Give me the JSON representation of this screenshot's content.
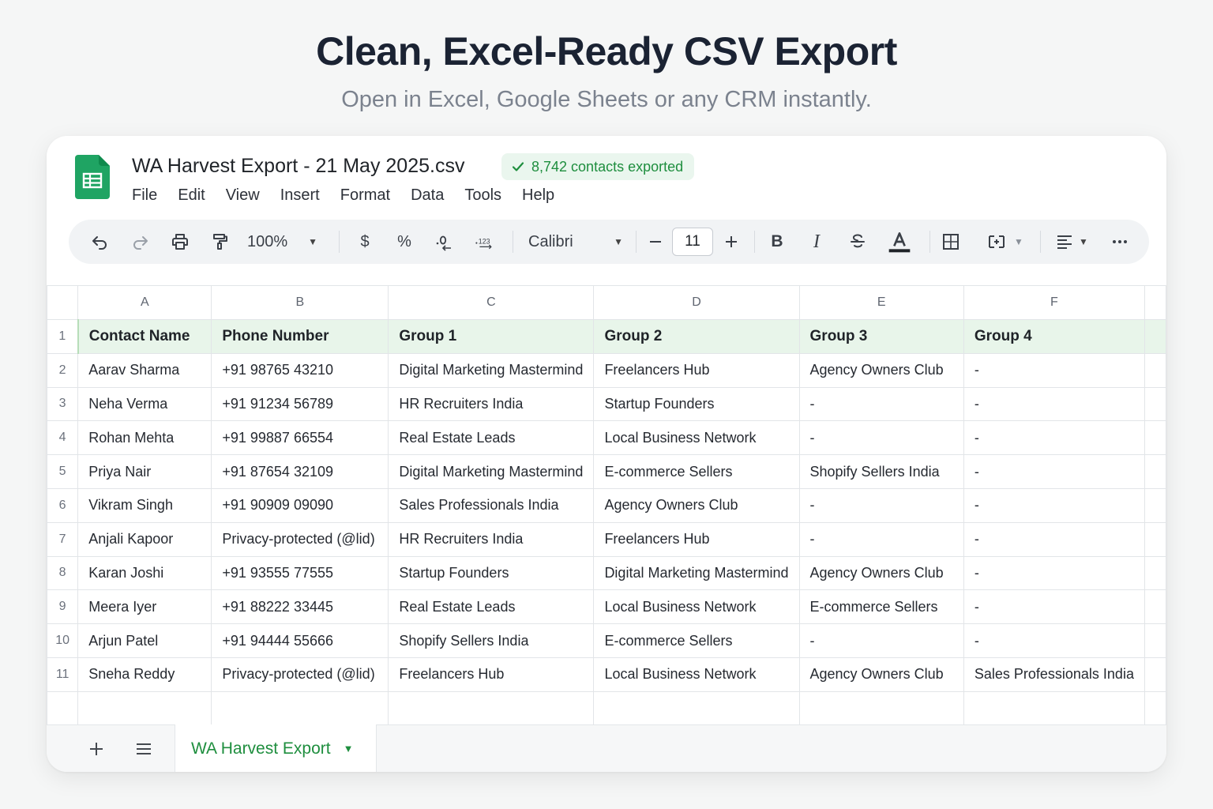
{
  "hero": {
    "title": "Clean, Excel-Ready CSV Export",
    "subtitle": "Open in Excel, Google Sheets or any CRM instantly."
  },
  "app": {
    "icon": "sheets-icon",
    "doc_title": "WA Harvest Export - 21 May 2025.csv",
    "badge": "8,742 contacts exported",
    "menu": [
      "File",
      "Edit",
      "View",
      "Insert",
      "Format",
      "Data",
      "Tools",
      "Help"
    ]
  },
  "toolbar": {
    "zoom": "100%",
    "currency": "$",
    "percent": "%",
    "font": "Calibri",
    "font_size": "11",
    "bold": "B",
    "italic": "I",
    "icons": [
      "undo-icon",
      "redo-icon",
      "print-icon",
      "paint-format-icon",
      "decrease-decimal-icon",
      "increase-decimal-icon",
      "strikethrough-icon",
      "text-color-icon",
      "borders-icon",
      "merge-cells-icon",
      "align-icon",
      "more-icon"
    ]
  },
  "grid": {
    "columns": [
      "A",
      "B",
      "C",
      "D",
      "E",
      "F"
    ],
    "rows": [
      {
        "num": "1",
        "cells": [
          "Contact Name",
          "Phone Number",
          "Group 1",
          "Group 2",
          "Group 3",
          "Group 4"
        ]
      },
      {
        "num": "2",
        "cells": [
          "Aarav Sharma",
          "+91 98765 43210",
          "Digital Marketing Mastermind",
          "Freelancers Hub",
          "Agency Owners Club",
          "-"
        ]
      },
      {
        "num": "3",
        "cells": [
          "Neha Verma",
          "+91 91234 56789",
          "HR Recruiters India",
          "Startup Founders",
          "-",
          "-"
        ]
      },
      {
        "num": "4",
        "cells": [
          "Rohan Mehta",
          "+91 99887 66554",
          "Real Estate Leads",
          "Local Business Network",
          "-",
          "-"
        ]
      },
      {
        "num": "5",
        "cells": [
          "Priya Nair",
          "+91 87654 32109",
          "Digital Marketing Mastermind",
          "E-commerce Sellers",
          "Shopify Sellers India",
          "-"
        ]
      },
      {
        "num": "6",
        "cells": [
          "Vikram Singh",
          "+91 90909 09090",
          "Sales Professionals India",
          "Agency Owners Club",
          "-",
          "-"
        ]
      },
      {
        "num": "7",
        "cells": [
          "Anjali Kapoor",
          "Privacy-protected (@lid)",
          "HR Recruiters India",
          "Freelancers Hub",
          "-",
          "-"
        ]
      },
      {
        "num": "8",
        "cells": [
          "Karan Joshi",
          "+91 93555 77555",
          "Startup Founders",
          "Digital Marketing Mastermind",
          "Agency Owners Club",
          "-"
        ]
      },
      {
        "num": "9",
        "cells": [
          "Meera Iyer",
          "+91 88222 33445",
          "Real Estate Leads",
          "Local Business Network",
          "E-commerce Sellers",
          "-"
        ]
      },
      {
        "num": "10",
        "cells": [
          "Arjun Patel",
          "+91 94444 55666",
          "Shopify Sellers India",
          "E-commerce Sellers",
          "-",
          "-"
        ]
      },
      {
        "num": "11",
        "cells": [
          "Sneha Reddy",
          "Privacy-protected (@lid)",
          "Freelancers Hub",
          "Local Business Network",
          "Agency Owners Club",
          "Sales Professionals India"
        ]
      }
    ]
  },
  "tabs": {
    "active": "WA Harvest Export"
  },
  "colors": {
    "accent": "#1e8e3e",
    "header_fill": "#e8f5ea"
  }
}
